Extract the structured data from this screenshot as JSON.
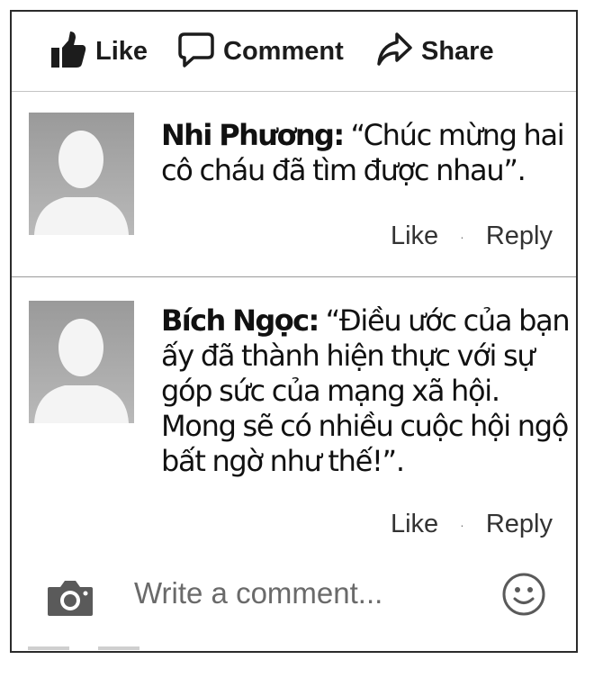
{
  "actions": {
    "like_label": "Like",
    "comment_label": "Comment",
    "share_label": "Share"
  },
  "comments": [
    {
      "author": "Nhi Phương:",
      "text": "“Chúc mừng hai cô cháu đã tìm được nhau”.",
      "like_label": "Like",
      "reply_label": "Reply",
      "separator": "·"
    },
    {
      "author": "Bích Ngọc:",
      "text": "“Điều ước của bạn ấy đã thành hiện thực với sự góp sức của mạng xã hội. Mong sẽ có nhiều cuộc hội ngộ bất ngờ như thế!”.",
      "like_label": "Like",
      "reply_label": "Reply",
      "separator": "·"
    }
  ],
  "composer": {
    "placeholder": "Write a comment..."
  },
  "icons": {
    "like": "thumbs-up-icon",
    "comment": "speech-bubble-icon",
    "share": "share-arrow-icon",
    "camera": "camera-icon",
    "emoji": "smiley-icon"
  },
  "colors": {
    "text": "#111111",
    "avatar_bg": "#a8a8a8",
    "divider": "#c4c4c4"
  }
}
